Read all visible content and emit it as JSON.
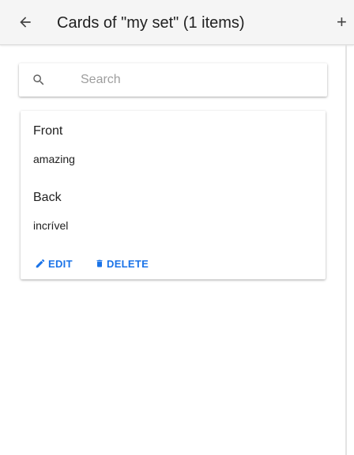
{
  "appbar": {
    "title": "Cards of \"my set\" (1 items)",
    "back_icon": "arrow-left-icon",
    "add_label": "+"
  },
  "search": {
    "placeholder": "Search",
    "value": "",
    "icon": "search-icon"
  },
  "cards": [
    {
      "front_label": "Front",
      "front_value": "amazing",
      "back_label": "Back",
      "back_value": "incrível",
      "edit_label": "EDIT",
      "delete_label": "DELETE"
    }
  ],
  "colors": {
    "accent": "#1a73e8",
    "appbar_bg": "#f5f5f5",
    "text": "#212121",
    "placeholder": "#9e9e9e"
  }
}
